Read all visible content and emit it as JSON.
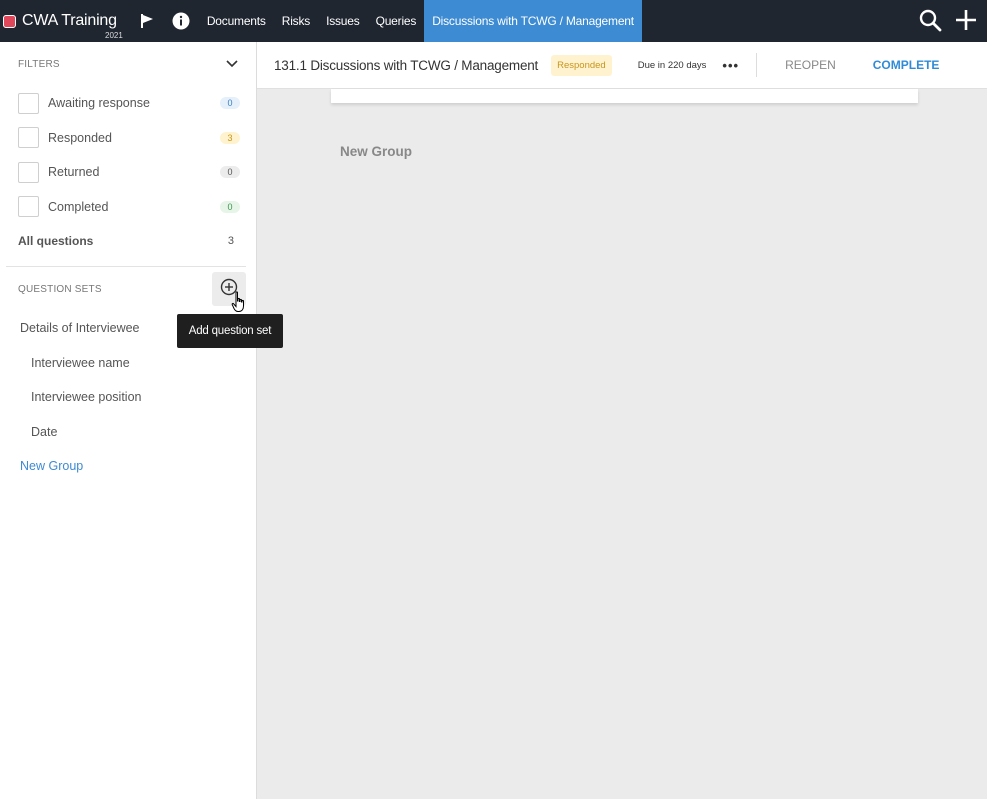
{
  "app": {
    "name": "CWA Training",
    "year": "2021"
  },
  "nav": {
    "tabs": [
      "Documents",
      "Risks",
      "Issues",
      "Queries",
      "Discussions with TCWG / Management"
    ],
    "active_tab": "Discussions with TCWG / Management"
  },
  "icons": {
    "flag": "flag-icon",
    "info": "info-icon",
    "search": "search-icon",
    "add": "plus-icon",
    "chevron": "chevron-down-icon",
    "add_question_set": "plus-circle-icon"
  },
  "sidebar": {
    "filters_label": "FILTERS",
    "filters": [
      {
        "label": "Awaiting response",
        "count": "0",
        "color": "blue"
      },
      {
        "label": "Responded",
        "count": "3",
        "color": "yellow"
      },
      {
        "label": "Returned",
        "count": "0",
        "color": "grey"
      },
      {
        "label": "Completed",
        "count": "0",
        "color": "green"
      }
    ],
    "all_questions_label": "All questions",
    "all_questions_count": "3",
    "question_sets_label": "QUESTION SETS",
    "question_sets": [
      {
        "label": "Details of Interviewee",
        "level": "group"
      },
      {
        "label": "Interviewee name",
        "level": "item"
      },
      {
        "label": "Interviewee position",
        "level": "item"
      },
      {
        "label": "Date",
        "level": "item"
      },
      {
        "label": "New Group",
        "level": "new"
      }
    ]
  },
  "tooltip": {
    "text": "Add question set"
  },
  "header": {
    "title": "131.1 Discussions with TCWG / Management",
    "status": "Responded",
    "due": "Due in 220 days",
    "more": "•••",
    "reopen": "REOPEN",
    "complete": "COMPLETE"
  },
  "main": {
    "group_title": "New Group"
  },
  "colors": {
    "topbar": "#1f2630",
    "accent": "#3d8bd2",
    "brand_dot": "#e0475a",
    "responded_bg": "#fff3cf",
    "responded_text": "#c7951d"
  }
}
